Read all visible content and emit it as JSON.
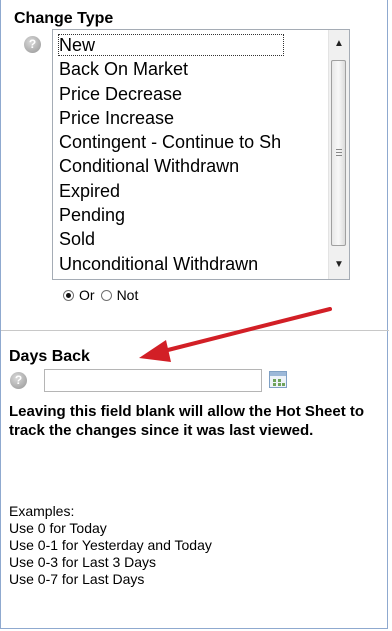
{
  "change_type": {
    "heading": "Change Type",
    "help_icon": "question-icon",
    "options": [
      "New",
      "Back On Market",
      "Price Decrease",
      "Price Increase",
      "Contingent - Continue to Sh",
      "Conditional Withdrawn",
      "Expired",
      "Pending",
      "Sold",
      "Unconditional Withdrawn"
    ],
    "selected_option": "New",
    "logic": {
      "or_label": "Or",
      "not_label": "Not",
      "selected": "Or"
    }
  },
  "days_back": {
    "heading": "Days Back",
    "help_icon": "question-icon",
    "value": "",
    "calendar_icon": "calendar-icon",
    "note": "Leaving this field blank will allow the Hot Sheet to track the changes since it was last viewed.",
    "examples_title": "Examples:",
    "examples": [
      "Use 0 for Today",
      "Use 0-1 for Yesterday and Today",
      "Use 0-3 for Last 3 Days",
      "Use 0-7 for Last Days"
    ]
  },
  "annotation_arrow_color": "#d21f26",
  "colors": {
    "panel_border": "#8fa9cf"
  }
}
